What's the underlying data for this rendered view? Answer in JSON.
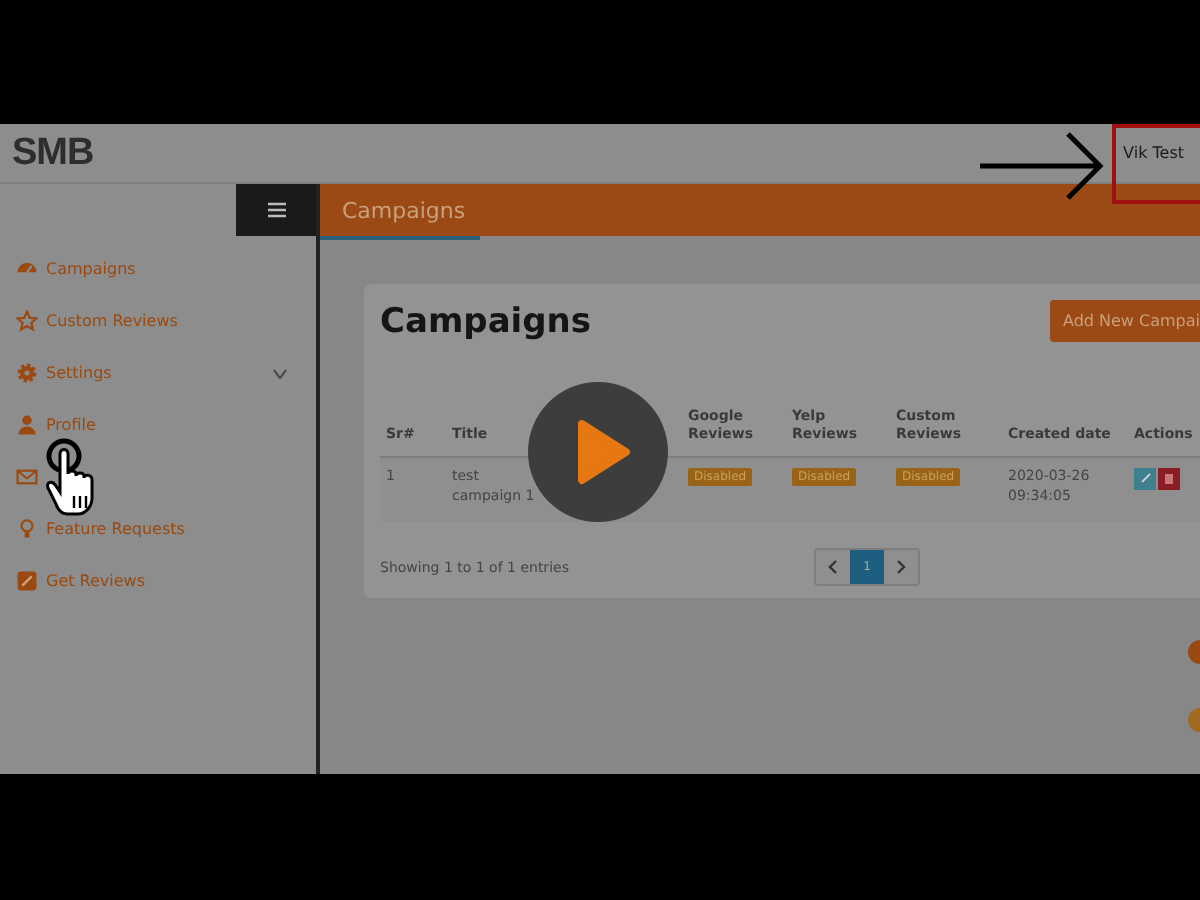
{
  "header": {
    "logo": "SMB",
    "user": "Vik Test"
  },
  "topbar": {
    "title": "Campaigns"
  },
  "sidebar": {
    "items": [
      {
        "kind": "gauge",
        "label": "Campaigns"
      },
      {
        "kind": "star",
        "label": "Custom Reviews"
      },
      {
        "kind": "gear",
        "label": "Settings",
        "expanded": false
      },
      {
        "kind": "person",
        "label": "Profile"
      },
      {
        "kind": "mail"
      },
      {
        "kind": "bulb",
        "label": "Feature Requests"
      },
      {
        "kind": "pencil",
        "label": "Get Reviews"
      }
    ]
  },
  "card": {
    "title": "Campaigns",
    "add_button": "Add New Campai",
    "table": {
      "columns": [
        "Sr#",
        "Title",
        "",
        "Google Reviews",
        "Yelp Reviews",
        "Custom Reviews",
        "Created date",
        "Actions"
      ],
      "rows": [
        {
          "cells": [
            "1",
            "test campaign 1",
            "",
            "Disabled",
            "Disabled",
            "Disabled",
            "2020-03-26 09:34:05"
          ]
        }
      ]
    },
    "footer": "Showing 1 to 1 of 1 entries",
    "pages": [
      {
        "label": "1",
        "selected": true
      }
    ]
  }
}
